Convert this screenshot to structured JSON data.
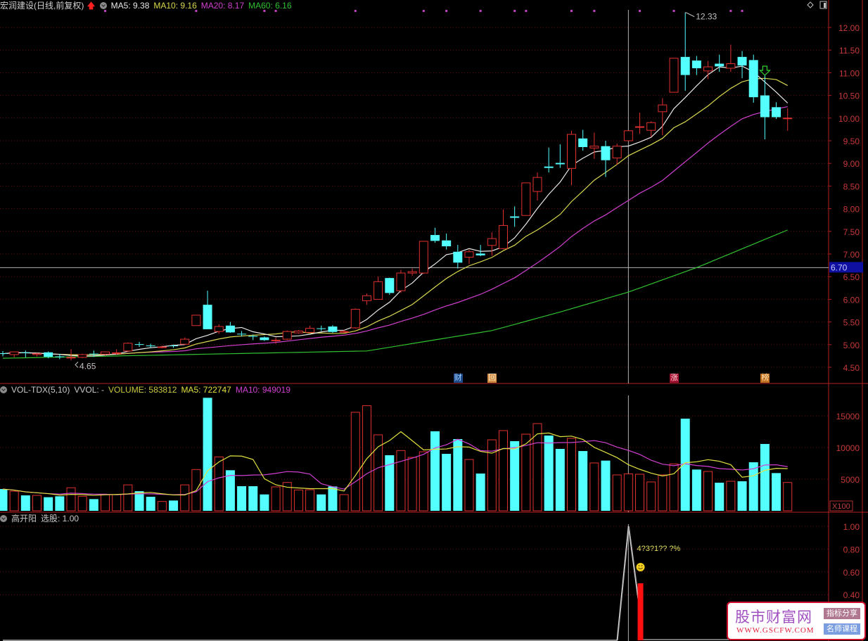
{
  "header": {
    "title": "宏润建设(日线,前复权)",
    "ma5": "MA5: 9.38",
    "ma10": "MA10: 9.16",
    "ma20": "MA20: 8.17",
    "ma60": "MA60: 6.16"
  },
  "volume_header": {
    "name": "VOL-TDX(5,10)",
    "vvol": "VVOL: -",
    "volume": "VOLUME: 583812",
    "ma5": "MA5: 722747",
    "ma10": "MA10: 949019"
  },
  "indicator_header": {
    "name": "高开阳",
    "value": "选股: 1.00"
  },
  "colors": {
    "up": "#e03030",
    "down": "#54ffff",
    "ma5": "#e8e8e8",
    "ma10": "#d8d850",
    "ma20": "#d040d0",
    "ma60": "#30c030",
    "axis": "#b02020",
    "grid": "#6a1010"
  },
  "annotations": {
    "high_label": "12.33",
    "low_label": "4.65",
    "crosshair_price": "6.70",
    "indicator_text": "4?3?1?? ?%",
    "volume_unit": "X100",
    "markers": [
      {
        "index": 40,
        "text": "财",
        "bg": "#1e4a8a",
        "fg": "#9fd0ff"
      },
      {
        "index": 43,
        "text": "回",
        "bg": "#d08a40",
        "fg": "#fff0d0"
      },
      {
        "index": 59,
        "text": "涨",
        "bg": "#a01030",
        "fg": "#ffd0d0"
      },
      {
        "index": 67,
        "text": "榜",
        "bg": "#c07020",
        "fg": "#ffe0b0"
      }
    ]
  },
  "watermark": {
    "title": "股市财富网",
    "url": "WWW.GSCFW.COM",
    "badge1": "指标分享",
    "badge2": "名师课程"
  },
  "chart_data": [
    {
      "type": "candlestick",
      "title": "",
      "ylim": [
        4.3,
        12.55
      ],
      "yticks": [
        "12.00",
        "11.50",
        "11.00",
        "10.50",
        "10.00",
        "9.50",
        "9.00",
        "8.50",
        "8.00",
        "7.50",
        "7.00",
        "6.50",
        "6.00",
        "5.50",
        "5.00",
        "4.50"
      ],
      "crosshair": {
        "index": 55,
        "price": 6.7
      },
      "ohlc": [
        [
          4.81,
          4.86,
          4.74,
          4.8
        ],
        [
          4.78,
          4.85,
          4.72,
          4.84
        ],
        [
          4.83,
          4.87,
          4.72,
          4.82
        ],
        [
          4.78,
          4.82,
          4.74,
          4.8
        ],
        [
          4.83,
          4.85,
          4.7,
          4.73
        ],
        [
          4.74,
          4.8,
          4.68,
          4.73
        ],
        [
          4.71,
          4.9,
          4.65,
          4.72
        ],
        [
          4.72,
          4.8,
          4.7,
          4.78
        ],
        [
          4.8,
          4.87,
          4.73,
          4.79
        ],
        [
          4.79,
          4.85,
          4.76,
          4.84
        ],
        [
          4.81,
          4.9,
          4.78,
          4.82
        ],
        [
          4.86,
          5.05,
          4.84,
          5.03
        ],
        [
          5.01,
          5.06,
          4.95,
          5.0
        ],
        [
          4.98,
          5.02,
          4.93,
          4.97
        ],
        [
          4.94,
          4.98,
          4.92,
          4.95
        ],
        [
          4.98,
          5.0,
          4.93,
          4.97
        ],
        [
          5.01,
          5.16,
          5.0,
          5.12
        ],
        [
          5.42,
          5.65,
          5.42,
          5.65
        ],
        [
          5.88,
          6.19,
          5.34,
          5.34
        ],
        [
          5.29,
          5.45,
          5.24,
          5.4
        ],
        [
          5.42,
          5.5,
          5.26,
          5.27
        ],
        [
          5.24,
          5.3,
          5.18,
          5.23
        ],
        [
          5.19,
          5.22,
          5.1,
          5.18
        ],
        [
          5.16,
          5.18,
          5.08,
          5.1
        ],
        [
          5.09,
          5.16,
          5.02,
          5.1
        ],
        [
          5.12,
          5.31,
          5.1,
          5.29
        ],
        [
          5.26,
          5.32,
          5.24,
          5.3
        ],
        [
          5.27,
          5.42,
          5.25,
          5.36
        ],
        [
          5.36,
          5.42,
          5.3,
          5.35
        ],
        [
          5.4,
          5.43,
          5.26,
          5.28
        ],
        [
          5.28,
          5.33,
          5.26,
          5.29
        ],
        [
          5.37,
          5.8,
          5.35,
          5.78
        ],
        [
          5.97,
          6.13,
          5.88,
          6.08
        ],
        [
          6.0,
          6.5,
          6.0,
          6.39
        ],
        [
          6.47,
          6.48,
          6.1,
          6.14
        ],
        [
          6.19,
          6.65,
          6.14,
          6.58
        ],
        [
          6.58,
          6.68,
          6.52,
          6.61
        ],
        [
          6.58,
          7.28,
          6.56,
          7.28
        ],
        [
          7.42,
          7.58,
          7.25,
          7.29
        ],
        [
          7.3,
          7.45,
          7.1,
          7.17
        ],
        [
          7.05,
          7.2,
          6.68,
          6.81
        ],
        [
          6.93,
          7.1,
          6.78,
          7.05
        ],
        [
          7.01,
          7.2,
          6.95,
          6.97
        ],
        [
          7.19,
          7.48,
          6.96,
          7.34
        ],
        [
          7.12,
          7.98,
          7.1,
          7.63
        ],
        [
          7.83,
          8.05,
          7.6,
          7.8
        ],
        [
          7.85,
          8.57,
          7.85,
          8.57
        ],
        [
          8.38,
          8.8,
          8.18,
          8.69
        ],
        [
          8.93,
          9.35,
          8.8,
          8.9
        ],
        [
          9.01,
          9.42,
          8.9,
          8.98
        ],
        [
          8.89,
          9.72,
          8.52,
          9.64
        ],
        [
          9.55,
          9.74,
          9.28,
          9.36
        ],
        [
          9.34,
          9.68,
          9.1,
          9.38
        ],
        [
          9.38,
          9.5,
          8.7,
          9.07
        ],
        [
          9.12,
          9.44,
          8.97,
          9.38
        ],
        [
          9.5,
          9.72,
          9.5,
          9.72
        ],
        [
          9.8,
          10.12,
          9.65,
          9.81
        ],
        [
          9.73,
          9.93,
          9.58,
          9.9
        ],
        [
          10.14,
          10.44,
          9.62,
          10.29
        ],
        [
          10.57,
          11.32,
          10.57,
          11.32
        ],
        [
          11.35,
          12.33,
          10.6,
          10.95
        ],
        [
          11.27,
          11.37,
          10.95,
          11.1
        ],
        [
          11.04,
          11.26,
          10.86,
          11.13
        ],
        [
          11.2,
          11.4,
          11.02,
          11.14
        ],
        [
          11.1,
          11.62,
          11.02,
          11.2
        ],
        [
          11.35,
          11.48,
          10.88,
          11.16
        ],
        [
          11.28,
          11.4,
          10.34,
          10.46
        ],
        [
          10.5,
          10.95,
          9.53,
          10.02
        ],
        [
          10.24,
          10.35,
          9.98,
          10.02
        ],
        [
          10.0,
          10.22,
          9.72,
          10.0
        ]
      ],
      "ma60_keypoints": [
        [
          0,
          4.7
        ],
        [
          32,
          4.86
        ],
        [
          43,
          5.31
        ],
        [
          49,
          5.72
        ],
        [
          55,
          6.16
        ],
        [
          61,
          6.7
        ],
        [
          69,
          7.53
        ]
      ],
      "top_dot_indices": [
        9,
        17,
        23,
        24,
        31,
        37,
        39,
        42,
        45,
        46,
        50,
        52,
        56,
        59,
        64,
        65
      ],
      "high_index": 60,
      "low_index": 6,
      "signal_arrow_index": 67
    },
    {
      "type": "bar",
      "title": "VOL-TDX(5,10)",
      "unit": "X100",
      "ylim": [
        0,
        18500
      ],
      "yticks": [
        "15000",
        "10000",
        "5000"
      ],
      "values": [
        3440,
        3100,
        2440,
        2440,
        2150,
        2300,
        3650,
        2300,
        1850,
        2560,
        2560,
        4100,
        3100,
        2220,
        1480,
        1630,
        4100,
        6520,
        17850,
        8520,
        6410,
        3890,
        3890,
        2590,
        3780,
        4480,
        3300,
        3330,
        2590,
        3850,
        2560,
        15560,
        16600,
        12000,
        8780,
        9520,
        8440,
        9330,
        12560,
        9000,
        11330,
        8110,
        5890,
        11220,
        12670,
        11000,
        12110,
        13780,
        11890,
        9780,
        11440,
        9440,
        7560,
        7930,
        5670,
        5838,
        5780,
        4560,
        5670,
        7410,
        14560,
        6520,
        6220,
        4440,
        4670,
        4670,
        7670,
        10560,
        5960,
        4480
      ]
    },
    {
      "type": "line",
      "title": "高开阳",
      "ylim": [
        0,
        1.05
      ],
      "yticks": [
        "1.00",
        "0.80",
        "0.60",
        "0.40"
      ],
      "signal_index": 55,
      "signal_value": 1.0,
      "bar_index": 56,
      "bar_value": 0.5
    }
  ]
}
